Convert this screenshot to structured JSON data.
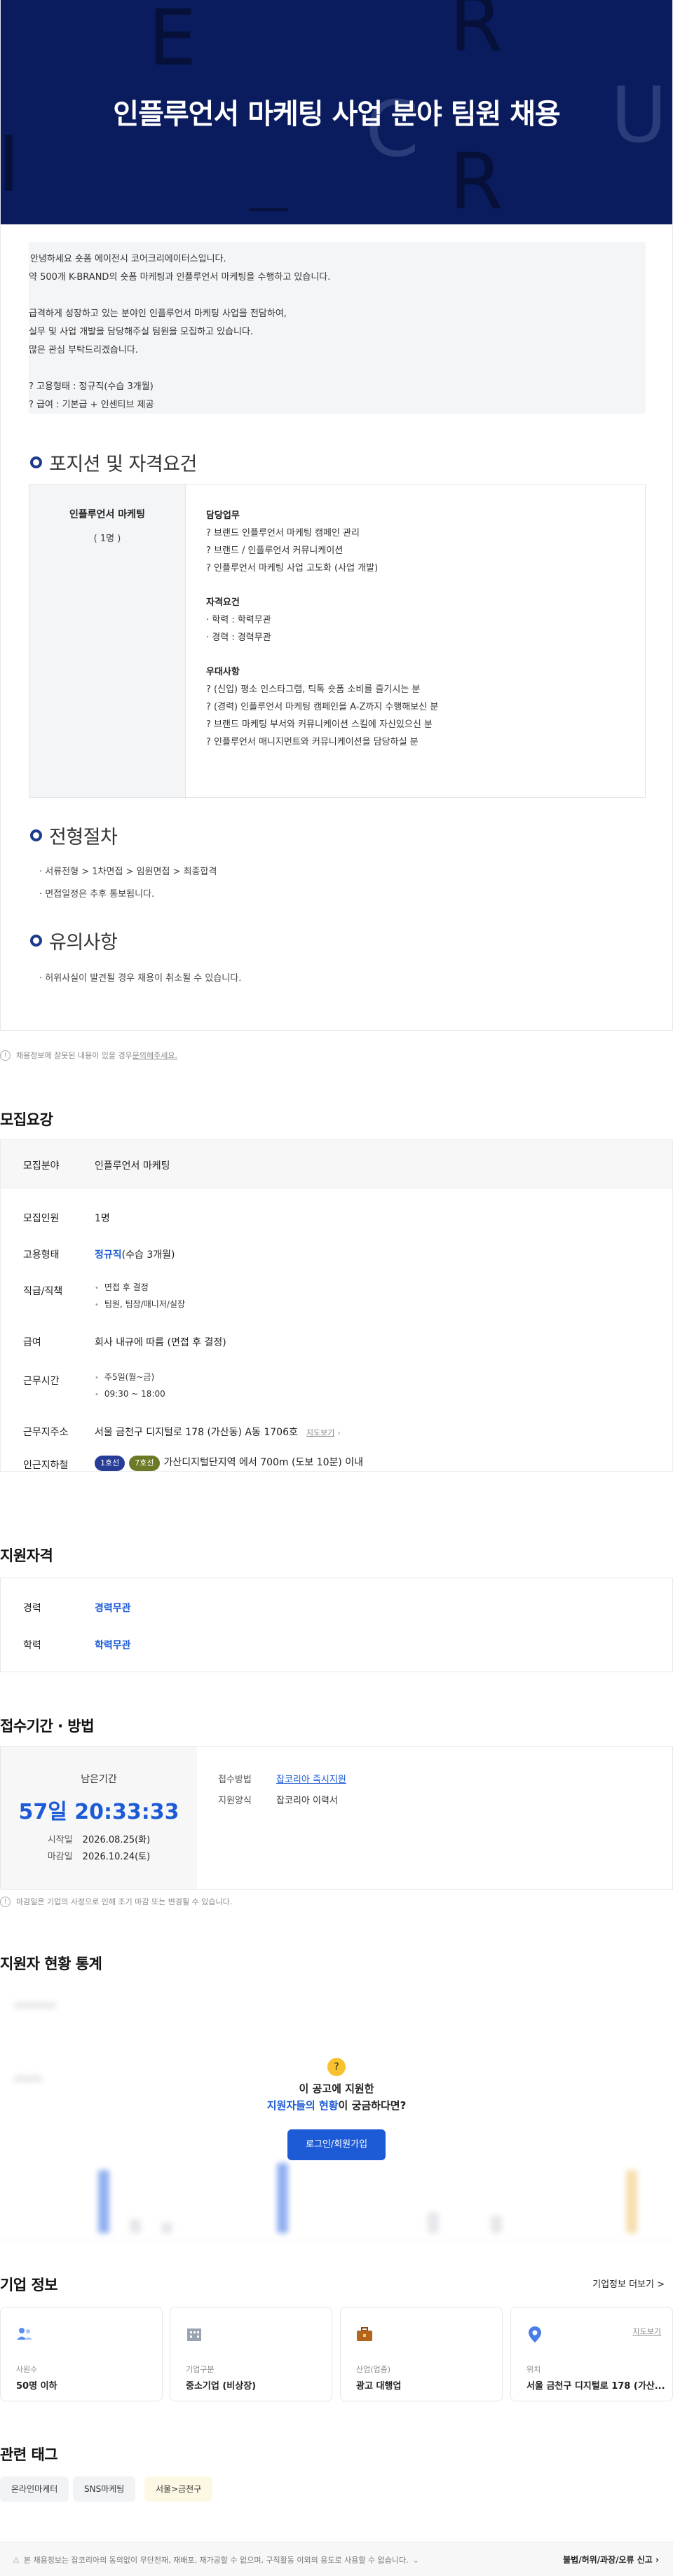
{
  "hero": {
    "title": "인플루언서 마케팅 사업 분야 팀원 채용",
    "deco_letters": [
      "E",
      "R",
      "C",
      "I",
      "R",
      "U"
    ]
  },
  "intro": {
    "lines": [
      "안녕하세요 숏폼 에이전시 코어크리에이터스입니다.",
      "약 500개 K-BRAND의 숏폼 마케팅과 인플루언서 마케팅을 수행하고 있습니다.",
      "",
      "급격하게 성장하고 있는 분야인 인플루언서 마케팅 사업을 전담하여,",
      "실무 및 사업 개발을 담당해주실 팀원을 모집하고 있습니다.",
      "많은 관심 부탁드리겠습니다.",
      "",
      "? 고용형태 : 정규직(수습 3개월)",
      "? 급여 : 기본급 + 인센티브 제공"
    ]
  },
  "sections": {
    "position": "포지션 및 자격요건",
    "process": "전형절차",
    "caution": "유의사항"
  },
  "position": {
    "name": "인플루언서 마케팅",
    "count": "( 1명 )",
    "duty_title": "담당업무",
    "duties": [
      "? 브랜드 인플루언서 마케팅 캠페인 관리",
      "? 브랜드 / 인플루언서 커뮤니케이션",
      "? 인플루언서 마케팅 사업 고도화 (사업 개발)"
    ],
    "qual_title": "자격요건",
    "quals": [
      "· 학력 : 학력무관",
      "· 경력 : 경력무관"
    ],
    "pref_title": "우대사항",
    "prefs": [
      "? (신입) 평소 인스타그램, 틱톡 숏폼 소비를 즐기시는 분",
      "? (경력) 인플루언서 마케팅 캠페인을 A-Z까지 수행해보신 분",
      "? 브랜드 마케팅 부서와 커뮤니케이션 스킬에 자신있으신 분",
      "? 인플루언서 매니지먼트와 커뮤니케이션을 담당하실 분"
    ]
  },
  "process": {
    "lines": [
      "· 서류전형 > 1차면접 > 임원면접 > 최종합격",
      "· 면접일정은 추후 통보됩니다."
    ]
  },
  "caution": {
    "lines": [
      "· 허위사실이 발견될 경우 채용이 취소될 수 있습니다."
    ]
  },
  "notice1": {
    "text": "채용정보에 잘못된 내용이 있을 경우 ",
    "link": "문의해주세요."
  },
  "recruit": {
    "title": "모집요강",
    "field_k": "모집분야",
    "field_v": "인플루언서 마케팅",
    "rows": {
      "count_k": "모집인원",
      "count_v": "1명",
      "type_k": "고용형태",
      "type_v_blue": "정규직",
      "type_v_rest": "(수습 3개월)",
      "rank_k": "직급/직책",
      "rank_v1": "면접 후 결정",
      "rank_v2": "팀원, 팀장/매니저/실장",
      "pay_k": "급여",
      "pay_v": "회사 내규에 따름 (면접 후 결정)",
      "time_k": "근무시간",
      "time_v1": "주5일(월~금)",
      "time_v2": "09:30 ~ 18:00",
      "addr_k": "근무지주소",
      "addr_v": "서울 금천구 디지털로 178 (가산동) A동 1706호",
      "addr_link": "지도보기",
      "subway_k": "인근지하철",
      "subway_b1": "1호선",
      "subway_b2": "7호선",
      "subway_v": "가산디지털단지역 에서 700m (도보 10분) 이내"
    }
  },
  "qualification": {
    "title": "지원자격",
    "career_k": "경력",
    "career_v": "경력무관",
    "edu_k": "학력",
    "edu_v": "학력무관"
  },
  "apply": {
    "title": "접수기간 · 방법",
    "remain_label": "남은기간",
    "countdown": "57일 20:33:33",
    "start_k": "시작일",
    "start_v": "2026.08.25(화)",
    "end_k": "마감일",
    "end_v": "2026.10.24(토)",
    "method_k": "접수방법",
    "method_v": "잡코리아 즉시지원",
    "form_k": "지원양식",
    "form_v": "잡코리아 이력서",
    "notice": "마감일은 기업의 사정으로 인해 조기 마감 또는 변경될 수 있습니다."
  },
  "stats": {
    "title": "지원자 현황 통계",
    "q1": "이 공고에 지원한",
    "q2_blue": "지원자들의 현황",
    "q2_rest": "이 궁금하다면?",
    "login_btn": "로그인/회원가입"
  },
  "company": {
    "title": "기업 정보",
    "more": "기업정보 더보기 >",
    "cards": [
      {
        "icon": "people-icon",
        "k": "사원수",
        "v": "50명 이하"
      },
      {
        "icon": "building-icon",
        "k": "기업구분",
        "v": "중소기업 (비상장)"
      },
      {
        "icon": "briefcase-icon",
        "k": "산업(업종)",
        "v": "광고 대행업"
      },
      {
        "icon": "location-pin-icon",
        "k": "위치",
        "v": "서울 금천구 디지털로 178 (가산...",
        "link": "지도보기"
      }
    ]
  },
  "tags": {
    "title": "관련 태그",
    "items": [
      "온라인마케터",
      "SNS마케팅",
      "서울>금천구"
    ]
  },
  "footer": {
    "left": "본 채용정보는 잡코리아의 동의없이 무단전재, 재배포, 재가공할 수 없으며, 구직활동 이외의 용도로 사용할 수 없습니다.",
    "right": "불법/허위/과장/오류 신고"
  },
  "colors": {
    "navy": "#0b1c5e",
    "blue": "#1d5bd6"
  }
}
